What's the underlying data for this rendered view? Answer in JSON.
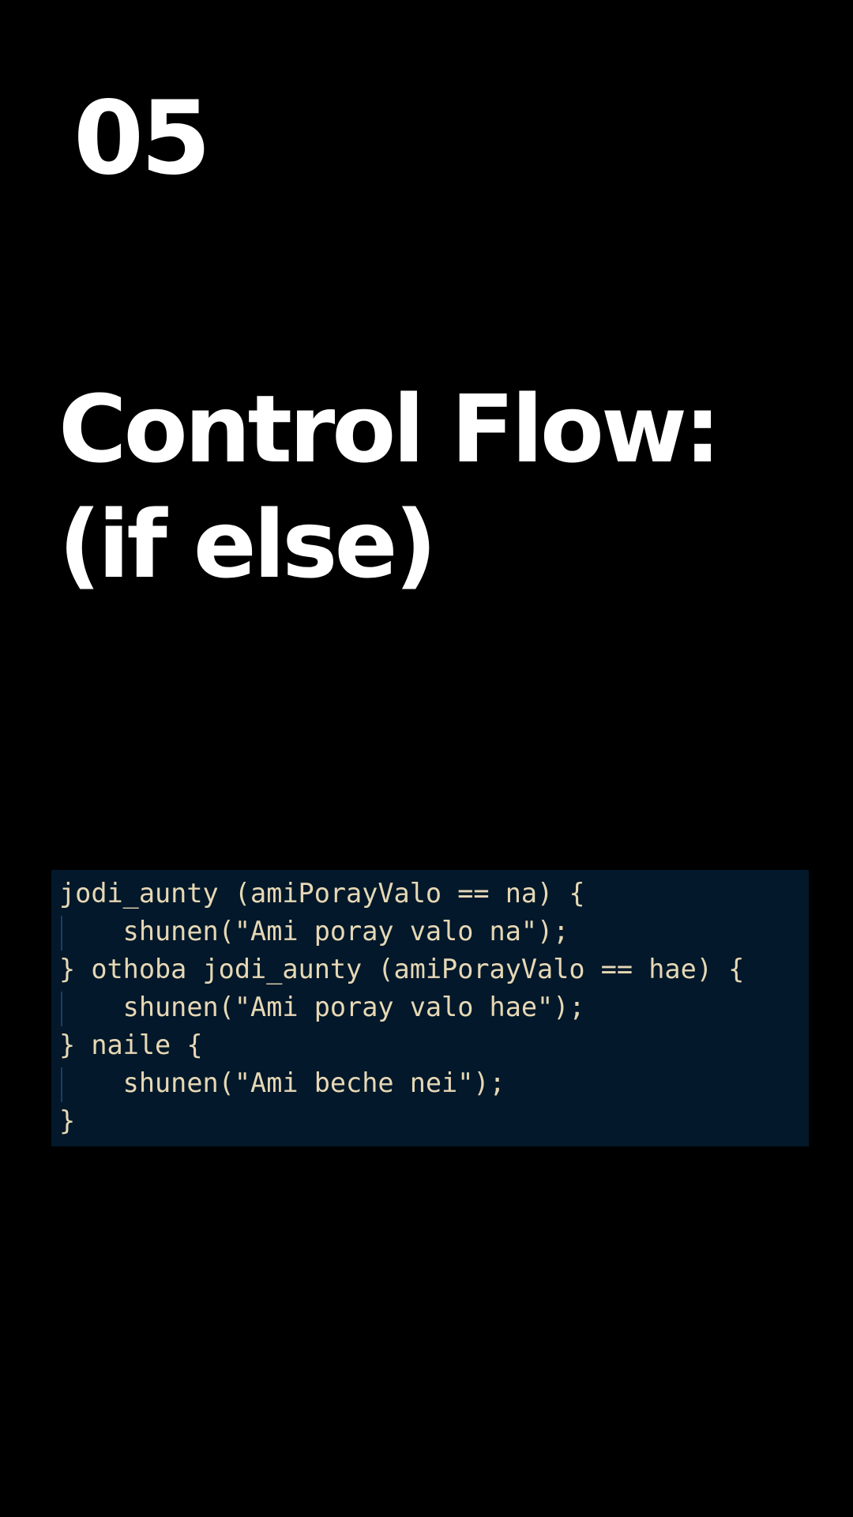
{
  "slide": {
    "number": "05",
    "title_line_1": "Control Flow:",
    "title_line_2": "(if else)"
  },
  "code": {
    "lines": [
      "jodi_aunty (amiPorayValo == na) {",
      "    shunen(\"Ami poray valo na\");",
      "} othoba jodi_aunty (amiPorayValo == hae) {",
      "    shunen(\"Ami poray valo hae\");",
      "} naile {",
      "    shunen(\"Ami beche nei\");",
      "}"
    ],
    "colors": {
      "background": "#03182a",
      "text": "#e6d8b5",
      "indent_guide": "#1f3c66"
    }
  }
}
